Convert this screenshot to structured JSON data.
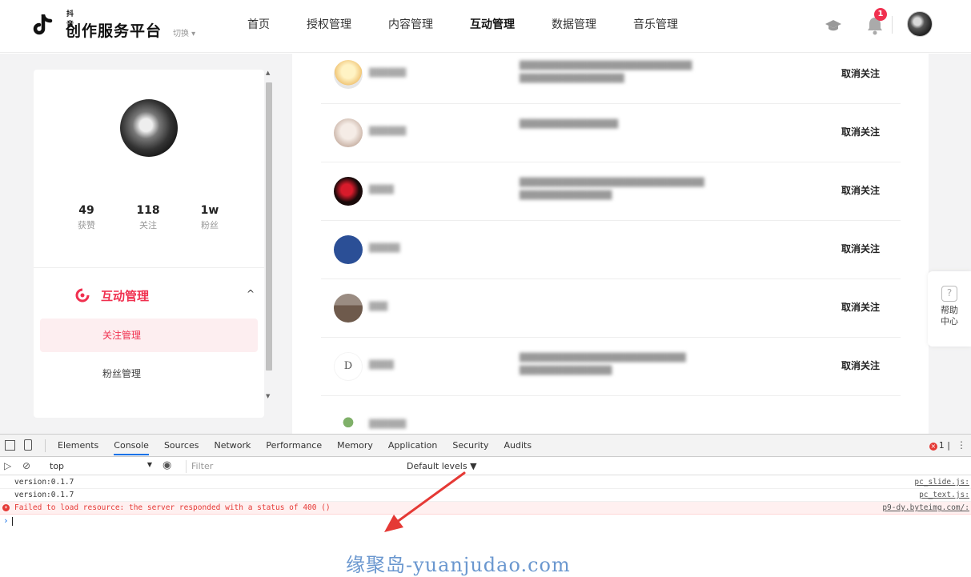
{
  "brand": {
    "small_text": "抖音",
    "name": "创作服务平台",
    "switch_label": "切换 ▾"
  },
  "nav": {
    "items": [
      "首页",
      "授权管理",
      "内容管理",
      "互动管理",
      "数据管理",
      "音乐管理"
    ],
    "active": "互动管理",
    "notification_count": "1",
    "icons": [
      "graduation-cap-icon",
      "bell-icon",
      "user-avatar"
    ]
  },
  "profile": {
    "stats": [
      {
        "value": "49",
        "label": "获赞"
      },
      {
        "value": "118",
        "label": "关注"
      },
      {
        "value": "1w",
        "label": "粉丝"
      }
    ]
  },
  "sidebar_menu": {
    "group_label": "互动管理",
    "group_icon": "interaction-icon",
    "chevron": "^",
    "items": [
      "关注管理",
      "粉丝管理"
    ],
    "active_item": "关注管理"
  },
  "follow_list": {
    "unfollow_label": "取消关注",
    "rows": [
      {
        "avatar_color": "#f3d9a0"
      },
      {
        "avatar_color": "#e8d6cc"
      },
      {
        "avatar_color": "#1a0a0a"
      },
      {
        "avatar_color": "#2b4f96"
      },
      {
        "avatar_color": "#8a7a70"
      },
      {
        "avatar_color": "#ffffff"
      }
    ]
  },
  "help": {
    "icon": "question-icon",
    "label": "帮助中心"
  },
  "devtools": {
    "tabs": [
      "Elements",
      "Console",
      "Sources",
      "Network",
      "Performance",
      "Memory",
      "Application",
      "Security",
      "Audits"
    ],
    "active_tab": "Console",
    "error_count": "1",
    "context": "top",
    "filter_placeholder": "Filter",
    "levels": "Default levels ▼",
    "lines": [
      {
        "text": "version:0.1.7",
        "source": "pc_slide.js:",
        "type": "log"
      },
      {
        "text": "version:0.1.7",
        "source": "pc_text.js:",
        "type": "log"
      },
      {
        "text": "Failed to load resource: the server responded with a status of 400 ()",
        "source": "p9-dy.byteimg.com/:",
        "type": "error"
      }
    ],
    "prompt": "›"
  },
  "watermark": "缘聚岛-yuanjudao.com",
  "colors": {
    "accent": "#f0304f",
    "active_bg": "#fdeef0",
    "annotation": "#e53935",
    "watermark": "#6a97cf"
  }
}
